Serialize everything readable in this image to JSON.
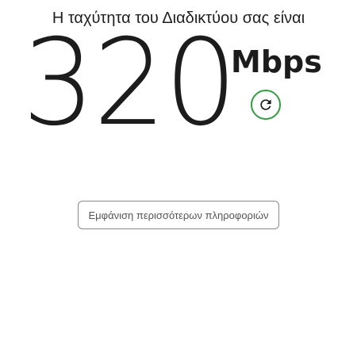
{
  "header": {
    "title": "Η ταχύτητα του Διαδικτύου σας είναι"
  },
  "speed": {
    "value": "320",
    "unit": "Mbps"
  },
  "refresh": {
    "icon": "refresh-icon",
    "accent_color": "#2e9e3e"
  },
  "more_info": {
    "label": "Εμφάνιση περισσότερων πληροφοριών"
  }
}
